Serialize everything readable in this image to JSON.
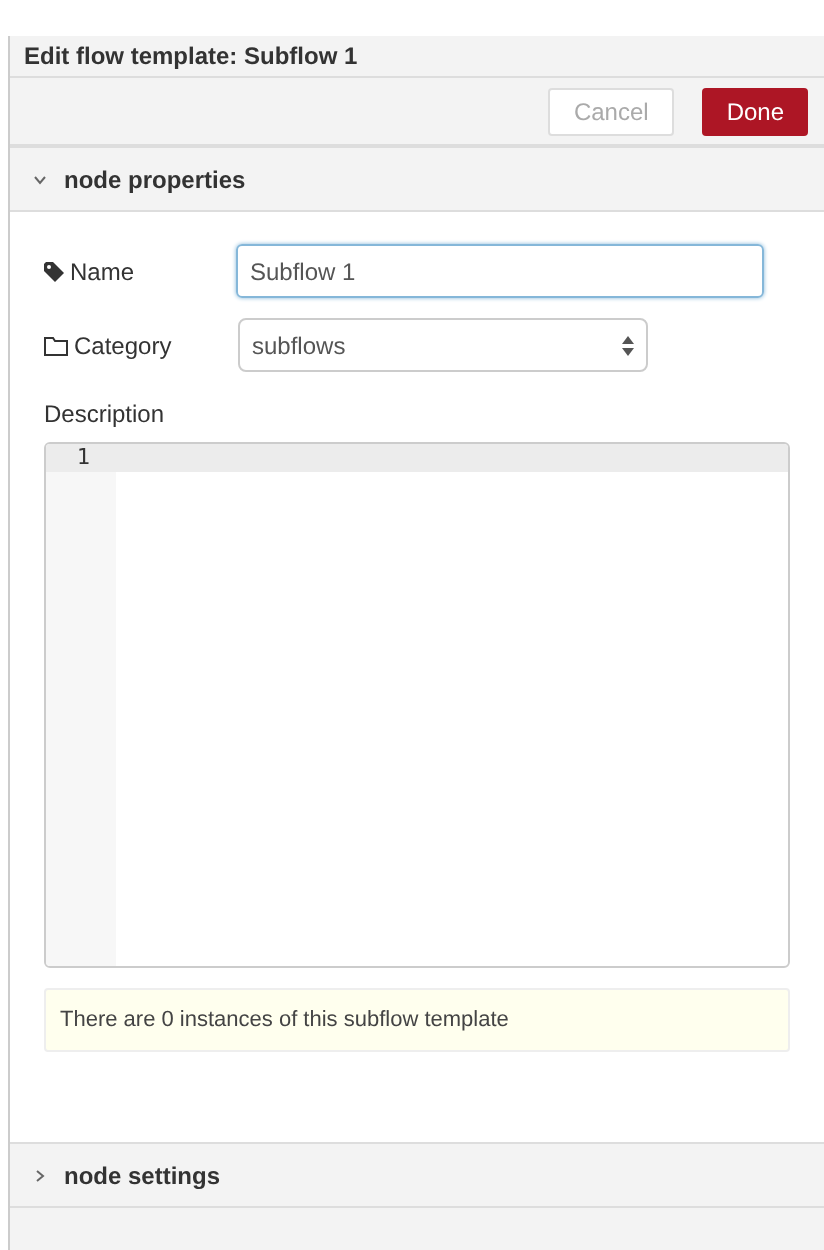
{
  "window": {
    "title": "Edit flow template: Subflow 1"
  },
  "buttons": [
    {
      "kind": "secondary",
      "label": "Cancel"
    },
    {
      "kind": "primary",
      "label": "Done"
    }
  ],
  "sections": [
    {
      "title": "node properties",
      "expanded": true
    },
    {
      "title": "node settings",
      "expanded": false
    }
  ],
  "form": {
    "name": {
      "label": "Name",
      "value": "Subflow 1",
      "focused": true
    },
    "category": {
      "label": "Category",
      "value": "subflows"
    },
    "description": {
      "label": "Description",
      "line_numbers": [
        "1"
      ]
    }
  },
  "info": "There are 0 instances of this subflow template"
}
